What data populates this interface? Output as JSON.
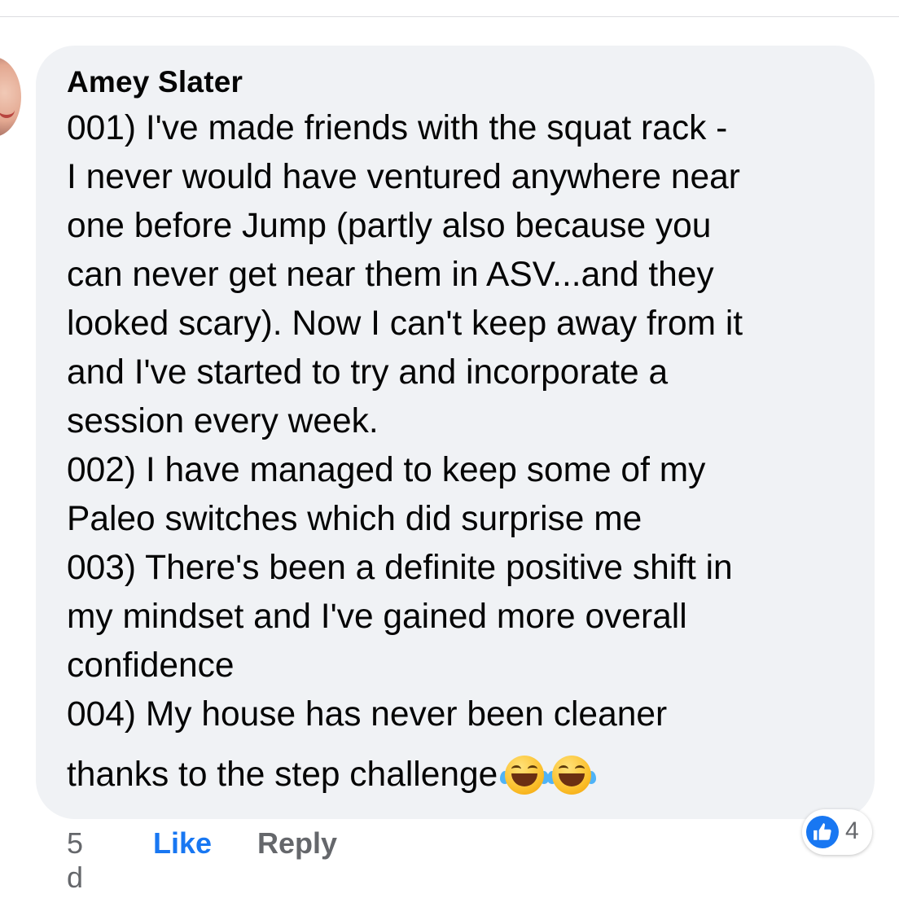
{
  "comment": {
    "author": "Amey Slater",
    "lines": [
      "001) I've made friends with the squat rack -",
      "I never would have ventured anywhere near",
      "one before Jump (partly also because you",
      "can never get near them in ASV...and they",
      "looked scary). Now I can't keep away from it",
      "and I've started to try and incorporate a",
      "session every week.",
      "002) I have managed to keep some of my",
      "Paleo switches which did surprise me",
      "003) There's been a definite positive shift in",
      "my mindset and I've gained more overall",
      "confidence",
      "004) My house has never been cleaner"
    ],
    "last_line": "thanks to the step challenge",
    "emojis": [
      "face-with-tears-of-joy-icon",
      "face-with-tears-of-joy-icon"
    ]
  },
  "footer": {
    "time": "5 d",
    "like_label": "Like",
    "reply_label": "Reply"
  },
  "reactions": {
    "icon": "thumbs-up-icon",
    "count": "4"
  },
  "colors": {
    "bubble": "#f0f2f5",
    "like_blue": "#1877f2",
    "secondary_text": "#65676b"
  }
}
